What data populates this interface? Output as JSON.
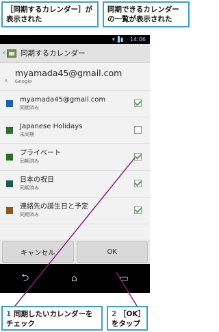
{
  "callouts": {
    "top_left": "［同期するカレンダー］が表示された",
    "top_right": "同期できるカレンダーの一覧が表示された",
    "step1_number": "1",
    "step1_text": "同期したいカレンダーをチェック",
    "step2_number": "2",
    "step2_text": "［OK］をタップ"
  },
  "status_bar": {
    "time": "14:06",
    "icons": "wifi-icon, signal-icon, battery-icon"
  },
  "action_bar": {
    "title": "同期するカレンダー"
  },
  "account": {
    "email": "myamada45@gmail.com",
    "provider": "Google"
  },
  "calendars": [
    {
      "name": "myamada45@gmail.com",
      "status": "同期済み",
      "color": "#1e5fb0",
      "checked": true
    },
    {
      "name": "Japanese Holidays",
      "status": "未同期",
      "color": "#2f6b2a",
      "checked": false
    },
    {
      "name": "プライベート",
      "status": "同期済み",
      "color": "#2f6b2a",
      "checked": true
    },
    {
      "name": "日本の祝日",
      "status": "同期済み",
      "color": "#1f5a52",
      "checked": true
    },
    {
      "name": "連絡先の誕生日と予定",
      "status": "同期済み",
      "color": "#8a5a1a",
      "checked": true
    }
  ],
  "buttons": {
    "cancel": "キャンセル",
    "ok": "OK"
  },
  "nav": {
    "back": "⮌",
    "home": "⌂",
    "recent": "▭"
  }
}
